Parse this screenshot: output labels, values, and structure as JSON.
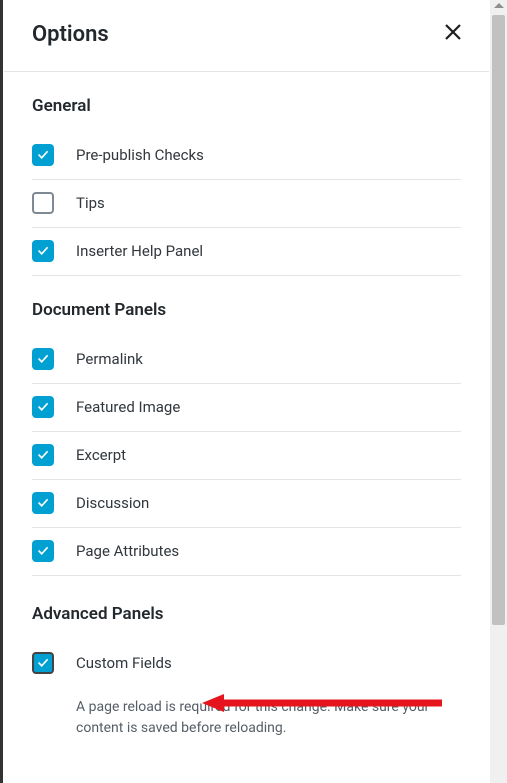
{
  "panel_title": "Options",
  "sections": {
    "general": {
      "heading": "General",
      "items": [
        {
          "label": "Pre-publish Checks",
          "checked": true
        },
        {
          "label": "Tips",
          "checked": false
        },
        {
          "label": "Inserter Help Panel",
          "checked": true
        }
      ]
    },
    "document_panels": {
      "heading": "Document Panels",
      "items": [
        {
          "label": "Permalink",
          "checked": true
        },
        {
          "label": "Featured Image",
          "checked": true
        },
        {
          "label": "Excerpt",
          "checked": true
        },
        {
          "label": "Discussion",
          "checked": true
        },
        {
          "label": "Page Attributes",
          "checked": true
        }
      ]
    },
    "advanced_panels": {
      "heading": "Advanced Panels",
      "items": [
        {
          "label": "Custom Fields",
          "checked": true,
          "outlined": true
        }
      ],
      "hint": "A page reload is required for this change. Make sure your content is saved before reloading."
    }
  }
}
